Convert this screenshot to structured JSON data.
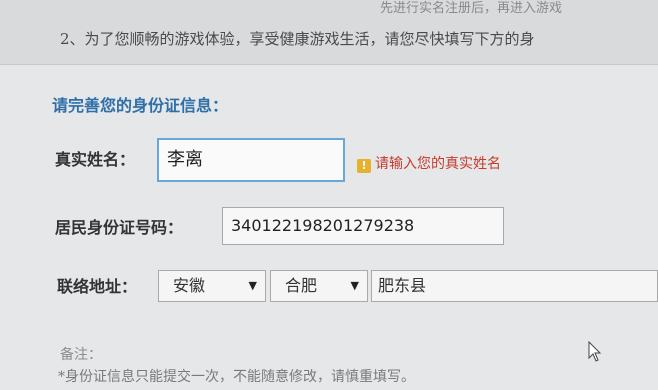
{
  "header": {
    "faded_line": "先进行实名注册后，再进入游戏",
    "intro_line": "2、为了您顺畅的游戏体验，享受健康游戏生活，请您尽快填写下方的身"
  },
  "form": {
    "section_title": "请完善您的身份证信息：",
    "name_label": "真实姓名：",
    "name_value": "李离",
    "name_hint": "请输入您的真实姓名",
    "id_label": "居民身份证号码：",
    "id_value": "340122198201279238",
    "address_label": "联络地址：",
    "province": "安徽",
    "city": "合肥",
    "district": "肥东县",
    "remark_label": "备注：",
    "remark_text": "*身份证信息只能提交一次，不能随意修改，请慎重填写。"
  },
  "icons": {
    "warning": "warning-icon",
    "dropdown": "triangle-down-icon",
    "pointer": "mouse-pointer-icon"
  },
  "colors": {
    "title": "#2f6fa8",
    "hint": "#c63a2c",
    "focus_border": "#6aa7d8",
    "warning": "#e6b12c"
  }
}
